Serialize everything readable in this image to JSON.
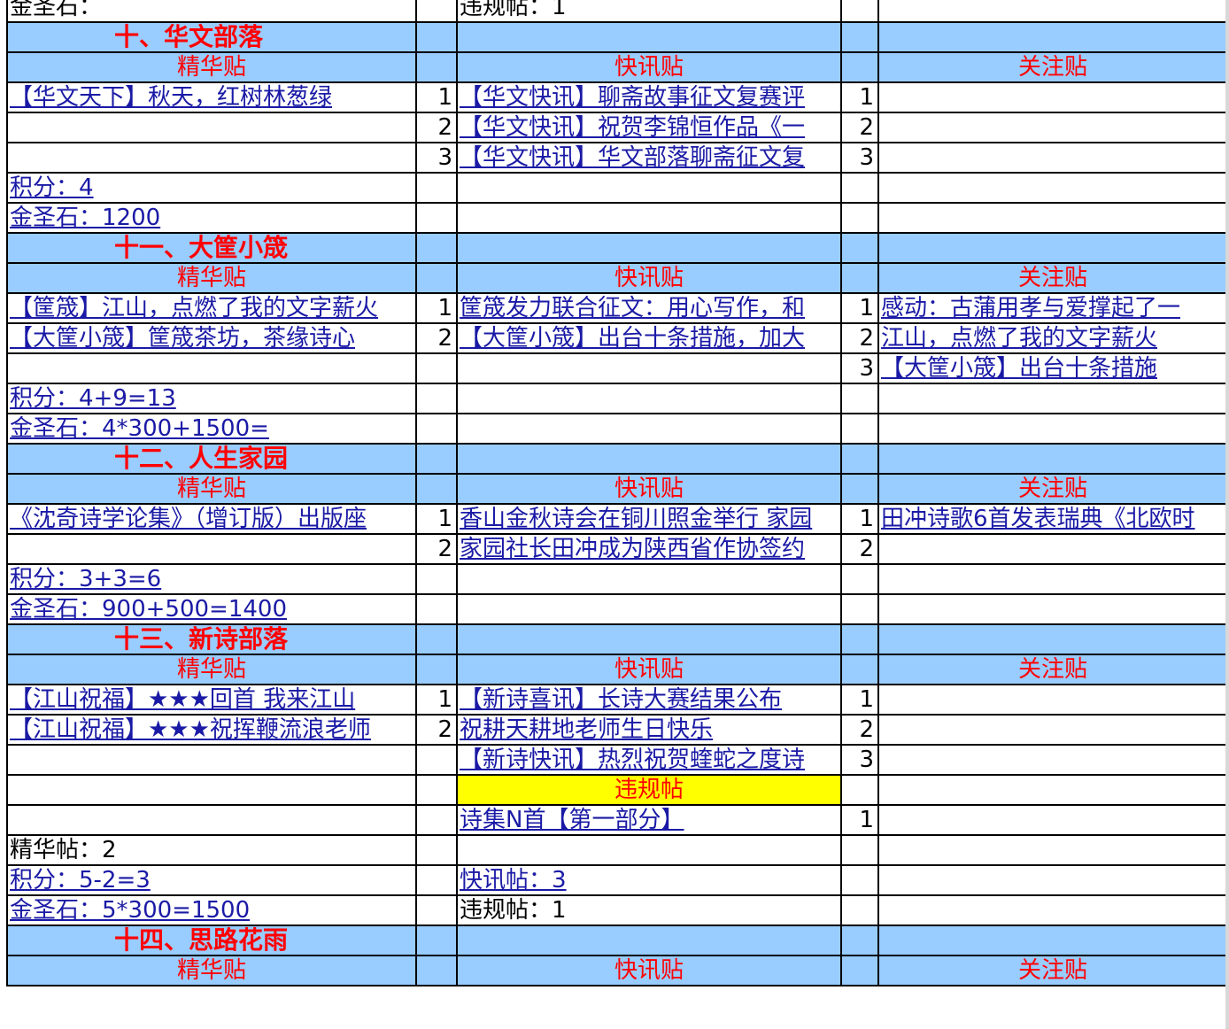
{
  "top_partial": {
    "left": "金圣石：",
    "mid": "违规帖：1"
  },
  "sections": [
    {
      "title": "十、华文部落",
      "head_left": "精华贴",
      "head_mid": "快讯贴",
      "head_right": "关注贴",
      "rows": [
        {
          "a": "【华文天下】秋天，红树林葱绿",
          "n1": "1",
          "b": "【华文快讯】聊斋故事征文复赛评",
          "n2": "1",
          "c": ""
        },
        {
          "a": "",
          "n1": "2",
          "b": "【华文快讯】祝贺李锦恒作品《一",
          "n2": "2",
          "c": ""
        },
        {
          "a": "",
          "n1": "3",
          "b": "【华文快讯】华文部落聊斋征文复",
          "n2": "3",
          "c": ""
        }
      ],
      "score": "积分：4",
      "stone": "金圣石：1200"
    },
    {
      "title": "十一、大筐小筬",
      "head_left": "精华贴",
      "head_mid": "快讯贴",
      "head_right": "关注贴",
      "rows": [
        {
          "a": "【筐筬】江山，点燃了我的文字薪火",
          "n1": "1",
          "b": "筐筬发力联合征文：用心写作，和",
          "n2": "1",
          "c": "感动：古蒲用孝与爱撑起了一"
        },
        {
          "a": "【大筐小筬】筐筬茶坊，茶缘诗心",
          "n1": "2",
          "b": "【大筐小筬】出台十条措施，加大",
          "n2": "2",
          "c": "江山，点燃了我的文字薪火"
        },
        {
          "a": "",
          "n1": "",
          "b": "",
          "n2": "3",
          "c": "【大筐小筬】出台十条措施"
        }
      ],
      "score": "积分：4+9=13",
      "stone": "金圣石：4*300+1500="
    },
    {
      "title": "十二、人生家园",
      "head_left": "精华贴",
      "head_mid": "快讯贴",
      "head_right": "关注贴",
      "rows": [
        {
          "a": "《沈奇诗学论集》（增订版）出版座",
          "n1": "1",
          "b": "香山金秋诗会在铜川照金举行 家园",
          "n2": "1",
          "c": "田冲诗歌6首发表瑞典《北欧时"
        },
        {
          "a": "",
          "n1": "2",
          "b": "家园社长田冲成为陕西省作协签约",
          "n2": "2",
          "c": ""
        }
      ],
      "score": "积分：3+3=6",
      "stone": "金圣石：900+500=1400"
    },
    {
      "title": "十三、新诗部落",
      "head_left": "精华贴",
      "head_mid": "快讯贴",
      "head_right": "关注贴",
      "rows": [
        {
          "a": "【江山祝福】★★★回首 我来江山",
          "n1": "1",
          "b": "【新诗喜讯】长诗大赛结果公布",
          "n2": "1",
          "c": ""
        },
        {
          "a": "【江山祝福】★★★祝挥鞭流浪老师",
          "n1": "2",
          "b": "祝耕天耕地老师生日快乐",
          "n2": "2",
          "c": ""
        },
        {
          "a": "",
          "n1": "",
          "b": "【新诗快讯】热烈祝贺蝰蛇之度诗",
          "n2": "3",
          "c": ""
        }
      ],
      "violation_head": "违规帖",
      "violation_rows": [
        {
          "b": "诗集N首【第一部分】",
          "n2": "1"
        }
      ],
      "summary_left": [
        "精华帖：2",
        "积分：5-2=3",
        "金圣石：5*300=1500"
      ],
      "summary_mid": [
        "",
        "快讯帖：3",
        "违规帖：1"
      ]
    },
    {
      "title": "十四、思路花雨",
      "head_left": "精华贴",
      "head_mid": "快讯贴",
      "head_right": "关注贴"
    }
  ],
  "colors": {
    "section_bar": "#99ccff",
    "header_text": "#ff0000",
    "link": "#1a1aa6",
    "violation_bg": "#ffff00"
  }
}
